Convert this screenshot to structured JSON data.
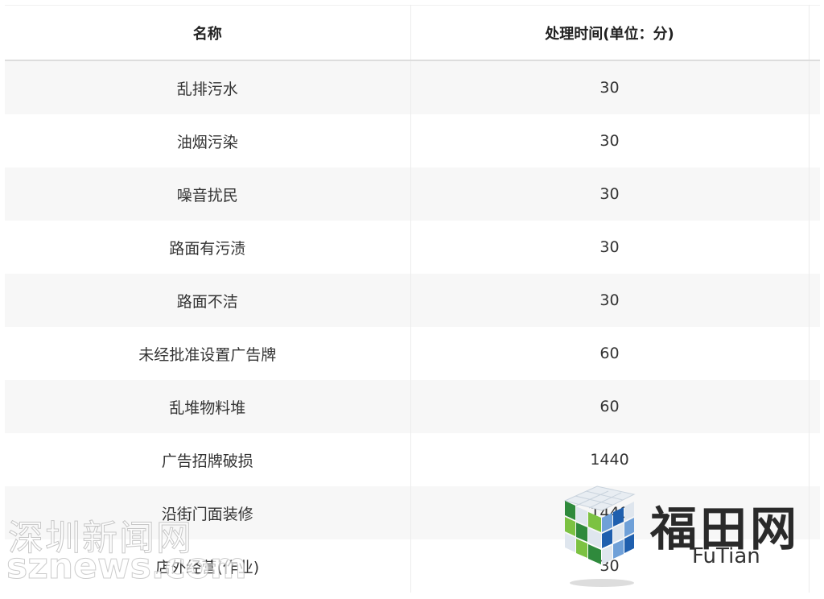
{
  "table": {
    "headers": {
      "name": "名称",
      "time": "处理时间(单位：分)"
    },
    "rows": [
      {
        "name": "乱排污水",
        "time": "30"
      },
      {
        "name": "油烟污染",
        "time": "30"
      },
      {
        "name": "噪音扰民",
        "time": "30"
      },
      {
        "name": "路面有污渍",
        "time": "30"
      },
      {
        "name": "路面不洁",
        "time": "30"
      },
      {
        "name": "未经批准设置广告牌",
        "time": "60"
      },
      {
        "name": "乱堆物料堆",
        "time": "60"
      },
      {
        "name": "广告招牌破损",
        "time": "1440"
      },
      {
        "name": "沿街门面装修",
        "time": "1440"
      },
      {
        "name": "店外经营(作业)",
        "time": "30"
      }
    ]
  },
  "watermarks": {
    "left_cn": "深圳新闻网",
    "left_en": "sznews.com",
    "right_cn": "福田网",
    "right_en": "FuTian",
    "logo_colors": [
      "#2f8a3c",
      "#7cc242",
      "#1f5fae",
      "#6fa0d8",
      "#dfe6ee"
    ]
  }
}
